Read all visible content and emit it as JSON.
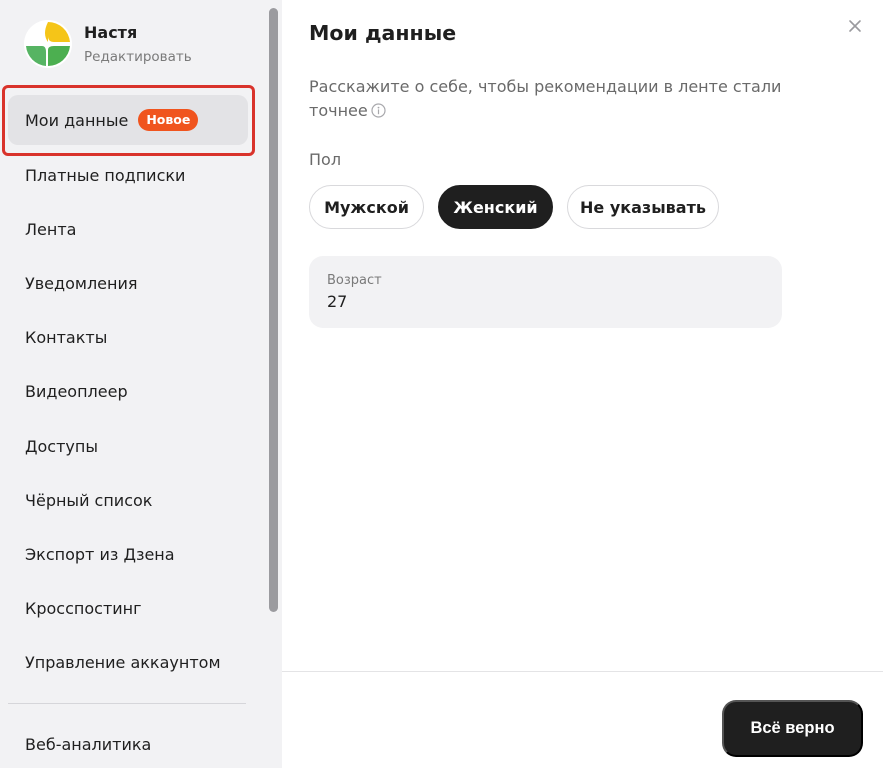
{
  "profile": {
    "name": "Настя",
    "edit_label": "Редактировать"
  },
  "sidebar": {
    "items": [
      {
        "label": "Мои данные",
        "badge": "Новое",
        "active": true
      },
      {
        "label": "Платные подписки"
      },
      {
        "label": "Лента"
      },
      {
        "label": "Уведомления"
      },
      {
        "label": "Контакты"
      },
      {
        "label": "Видеоплеер"
      },
      {
        "label": "Доступы"
      },
      {
        "label": "Чёрный список"
      },
      {
        "label": "Экспорт из Дзена"
      },
      {
        "label": "Кросспостинг"
      },
      {
        "label": "Управление аккаунтом"
      },
      {
        "label": "Веб-аналитика"
      }
    ]
  },
  "main": {
    "title": "Мои данные",
    "description": "Расскажите о себе, чтобы рекомендации в ленте стали точнее",
    "gender": {
      "label": "Пол",
      "options": [
        "Мужской",
        "Женский",
        "Не указывать"
      ],
      "selected": "Женский"
    },
    "age": {
      "label": "Возраст",
      "value": "27"
    },
    "confirm_label": "Всё верно"
  },
  "icons": {
    "avatar": "avatar-logo-icon",
    "close": "close-icon",
    "info": "info-icon"
  },
  "colors": {
    "badge": "#f0541e",
    "highlight": "#d9332b",
    "dark_button": "#1f1f1f",
    "sidebar_bg": "#f2f2f4"
  }
}
